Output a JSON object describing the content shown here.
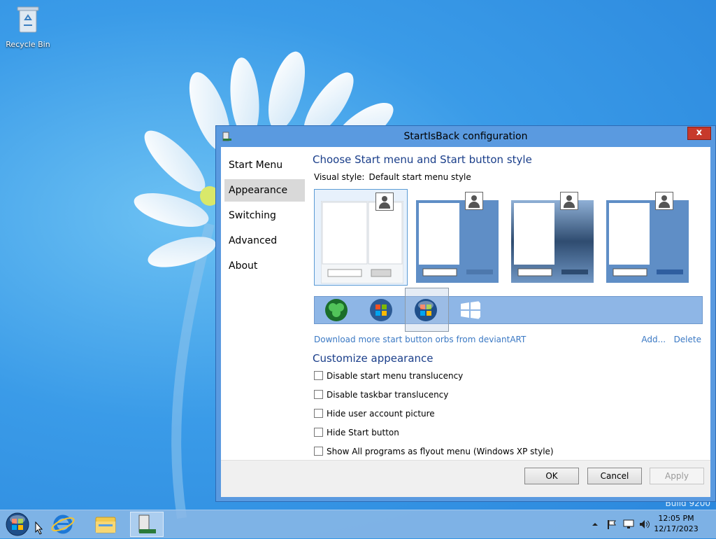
{
  "desktop": {
    "recycle_bin_label": "Recycle Bin",
    "build_text": "Build 9200"
  },
  "window": {
    "title": "StartIsBack configuration",
    "close_label": "x"
  },
  "nav": {
    "items": [
      {
        "label": "Start Menu",
        "selected": false
      },
      {
        "label": "Appearance",
        "selected": true
      },
      {
        "label": "Switching",
        "selected": false
      },
      {
        "label": "Advanced",
        "selected": false
      },
      {
        "label": "About",
        "selected": false
      }
    ]
  },
  "appearance": {
    "heading": "Choose Start menu and Start button style",
    "visual_style_label": "Visual style:",
    "visual_style_value": "Default start menu style",
    "selected_style_index": 0,
    "orbs": [
      "clover-orb",
      "windows-orb",
      "windows-orb-glossy",
      "windows8-logo"
    ],
    "selected_orb_index": 2,
    "download_link": "Download more start button orbs from deviantART",
    "add_link": "Add...",
    "delete_link": "Delete",
    "customize_heading": "Customize appearance",
    "options": [
      {
        "label": "Disable start menu translucency",
        "checked": false
      },
      {
        "label": "Disable taskbar translucency",
        "checked": false
      },
      {
        "label": "Hide user account picture",
        "checked": false
      },
      {
        "label": "Hide Start button",
        "checked": false
      },
      {
        "label": "Show All programs as flyout menu (Windows XP style)",
        "checked": false
      }
    ]
  },
  "buttons": {
    "ok": "OK",
    "cancel": "Cancel",
    "apply": "Apply"
  },
  "taskbar": {
    "time": "12:05 PM",
    "date": "12/17/2023",
    "pinned": [
      "start-orb",
      "internet-explorer",
      "file-explorer",
      "startisback-config"
    ]
  },
  "colors": {
    "accent": "#5a9ae0",
    "heading": "#1a3e8a",
    "link": "#3b79c4",
    "close": "#c7392b"
  }
}
